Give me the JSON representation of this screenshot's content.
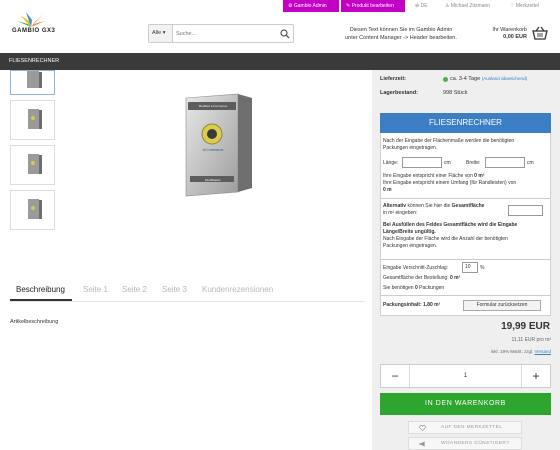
{
  "admin_bar": {
    "gambio_admin": "Gambio Admin",
    "produkt_bearbeiten": "Produkt bearbeiten",
    "language": "DE",
    "user": "Michael Zitzmann",
    "merkzettel": "Merkzettel",
    "accent_color": "#c400c4"
  },
  "header": {
    "logo_text": "GAMBIO GX3",
    "search_category": "Alle",
    "search_placeholder": "Suche...",
    "note_line1": "Diesen Text können Sie im Gambio Admin",
    "note_line2": "unter Content Manager -> Header bearbeiten.",
    "cart_label": "Ihr Warenkorb",
    "cart_amount": "0,00 EUR"
  },
  "nav": {
    "item": "FLIESENRECHNER"
  },
  "product": {
    "box_text_top": "Modified eCommerce",
    "box_text_mid": "xt:Commerce",
    "box_text_bottom": "Modifikation"
  },
  "tabs": [
    {
      "label": "Beschreibung",
      "active": true
    },
    {
      "label": "Seite 1"
    },
    {
      "label": "Seite 2"
    },
    {
      "label": "Seite 3"
    },
    {
      "label": "Kundenrezensionen"
    }
  ],
  "article_description": "Artikelbeschreibung",
  "specs": {
    "lieferzeit_label": "Lieferzeit:",
    "lieferzeit_value": "ca. 3-4 Tage",
    "lieferzeit_link": "(Ausland abweichend)",
    "lagerbestand_label": "Lagerbestand:",
    "lagerbestand_value": "998 Stück",
    "status_color": "#4cae4c"
  },
  "calculator": {
    "title": "FLIESENRECHNER",
    "intro_line1": "Nach der Eingabe der Flächenmaße werden die benötigten",
    "intro_line2": "Packungen eingetragen.",
    "laenge_label": "Länge:",
    "breite_label": "Breite:",
    "unit_cm": "cm",
    "flaeche_line_prefix": "Ihre Eingabe entspricht einer Fläche von",
    "flaeche_value": "0 m²",
    "umfang_line": "Ihre Eingabe entspricht einem Umfang (für Randleisten) von",
    "umfang_value": "0 m",
    "alt_bold": "Alternativ",
    "alt_text": "können Sie hier die",
    "alt_bold2": "Gesamtfläche",
    "alt_line2": "in m² eingeben:",
    "warn_line1": "Bei Ausfüllen des Feldes Gesamtfläche wird die Eingabe",
    "warn_line2": "Länge/Breite ungültig.",
    "info_line1": "Nach Eingabe der Fläche wird die Anzahl der benötigten",
    "info_line2": "Packungen eingetragen.",
    "verschnitt_label": "Eingabe Verschnitt-Zuschlag:",
    "verschnitt_value": "10",
    "verschnitt_unit": "%",
    "bestell_label": "Gesamtfläche der Bestellung:",
    "bestell_value": "0 m²",
    "packungen_prefix": "Sie benötigen",
    "packungen_value": "0",
    "packungen_suffix": "Packungen",
    "inhalt_label": "Packungsinhalt:",
    "inhalt_value": "1.80 m²",
    "reset_label": "Formular zurücksetzen",
    "header_color": "#3b7ec4"
  },
  "pricing": {
    "price": "19,99 EUR",
    "unit_price": "11,11 EUR pro m²",
    "vat_text": "inkl. 19% MwSt. zzgl.",
    "vat_link": "Versand"
  },
  "quantity": {
    "minus": "−",
    "value": "1",
    "plus": "+"
  },
  "buttons": {
    "add_to_cart": "IN DEN WARENKORB",
    "add_to_cart_color": "#2ea52e",
    "merkzettel": "AUF DEN MERKZETTEL",
    "cheaper": "WOANDERS GÜNSTIGER?"
  }
}
